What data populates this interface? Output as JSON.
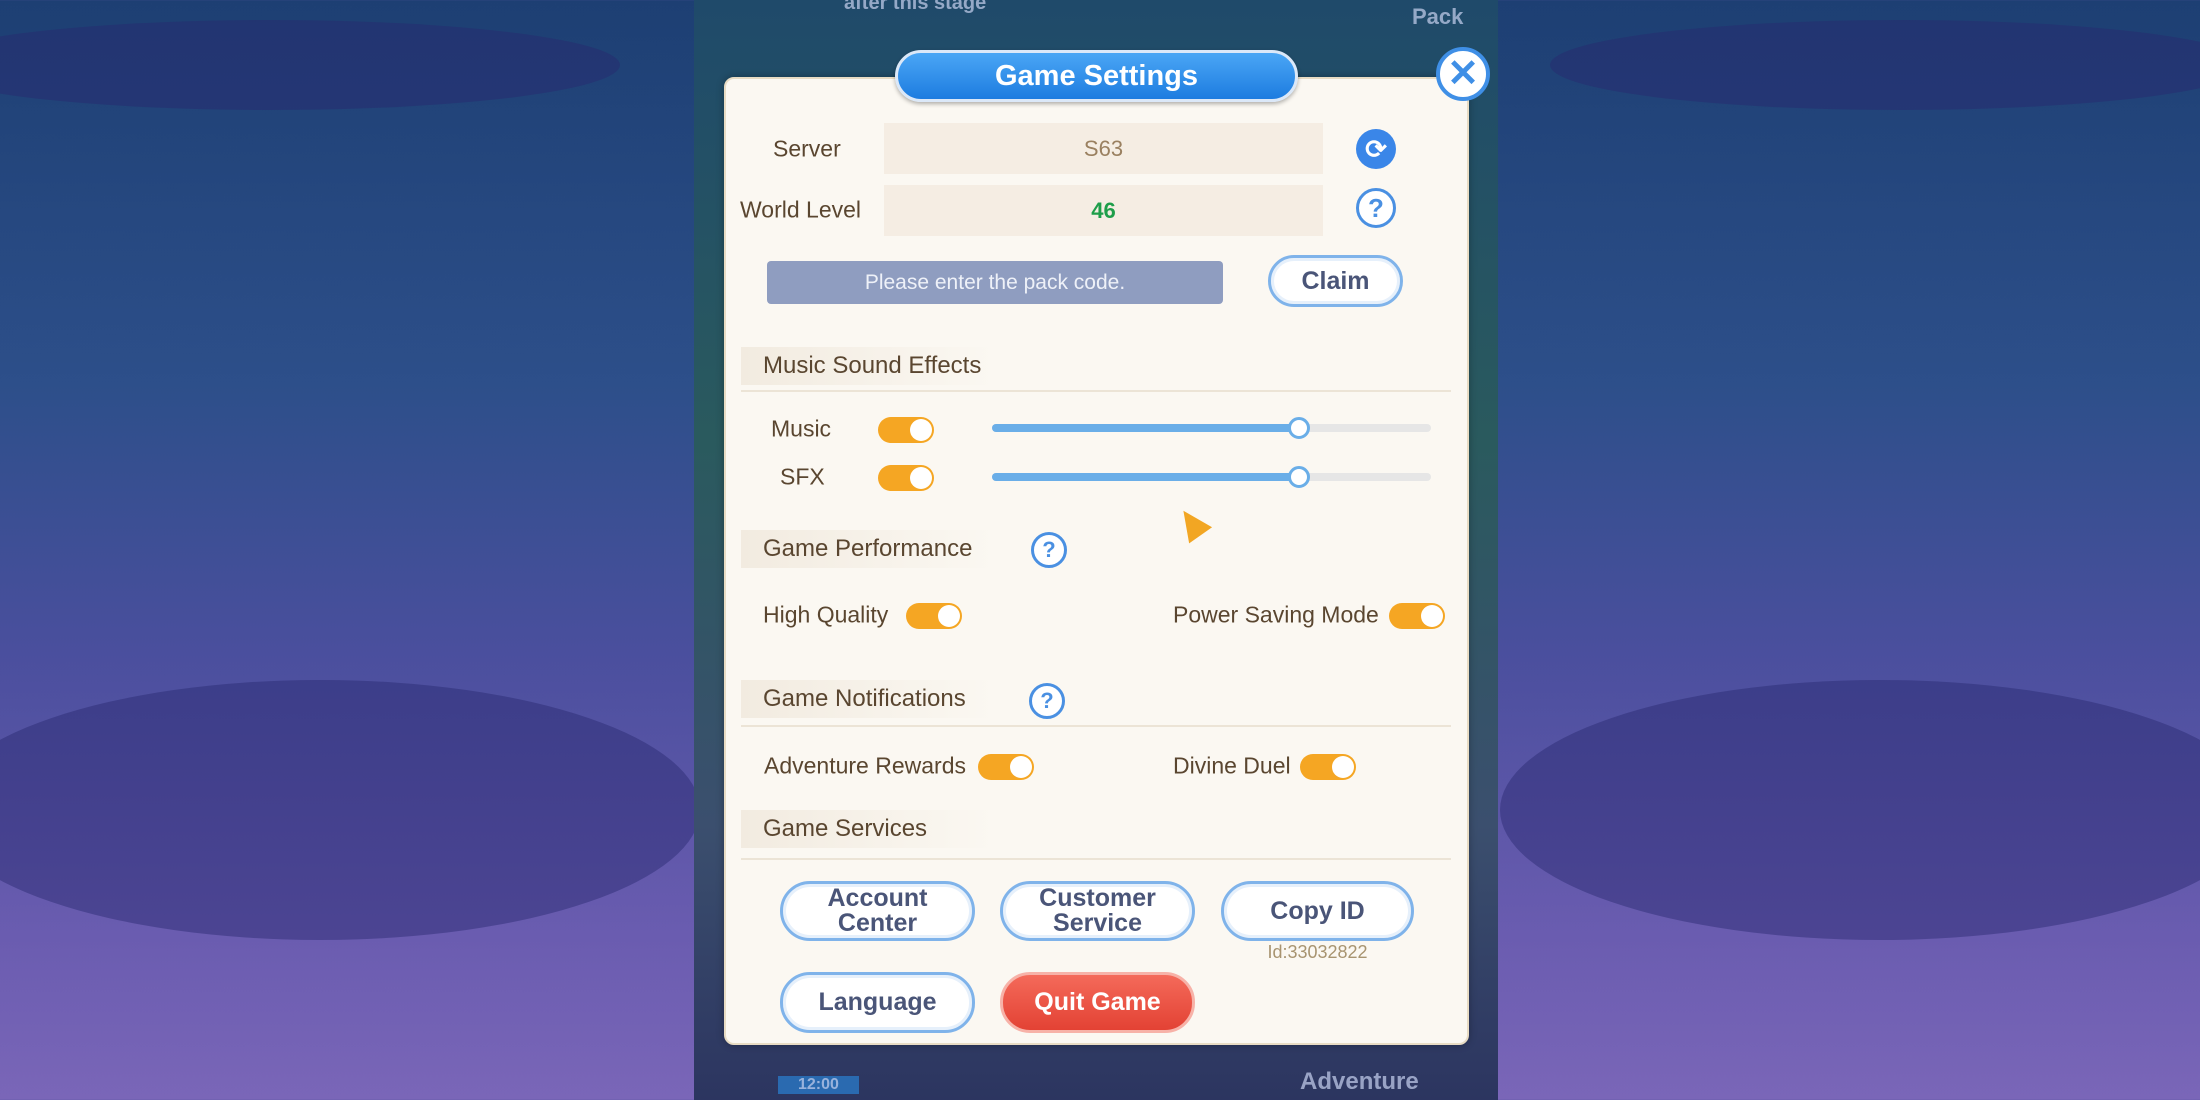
{
  "background": {
    "stage_text": "after this stage",
    "pack_text": "Pack",
    "adventure_text": "Adventure",
    "timer_text": "12:00"
  },
  "dialog": {
    "title": "Game Settings",
    "close_icon": "close-icon",
    "server": {
      "label": "Server",
      "value": "S63",
      "icon": "refresh-icon"
    },
    "world_level": {
      "label": "World Level",
      "value": "46",
      "value_color": "#1e9e4a",
      "icon": "help-icon"
    },
    "pack_code": {
      "placeholder": "Please enter the pack code.",
      "claim_label": "Claim"
    },
    "music_section": {
      "title": "Music Sound Effects",
      "music": {
        "label": "Music",
        "enabled": true,
        "volume": 0.7
      },
      "sfx": {
        "label": "SFX",
        "enabled": true,
        "volume": 0.7
      }
    },
    "performance_section": {
      "title": "Game Performance",
      "high_quality": {
        "label": "High Quality",
        "enabled": true
      },
      "power_saving": {
        "label": "Power Saving Mode",
        "enabled": true
      }
    },
    "notifications_section": {
      "title": "Game Notifications",
      "adventure_rewards": {
        "label": "Adventure Rewards",
        "enabled": true
      },
      "divine_duel": {
        "label": "Divine Duel",
        "enabled": true
      }
    },
    "services_section": {
      "title": "Game Services",
      "account_center": "Account Center",
      "customer_service": "Customer Service",
      "copy_id": "Copy ID",
      "id_text": "Id:33032822",
      "language": "Language",
      "quit_game": "Quit Game"
    }
  },
  "colors": {
    "accent": "#1d7ce0",
    "toggle_on": "#f5a623",
    "quit": "#e34234"
  }
}
